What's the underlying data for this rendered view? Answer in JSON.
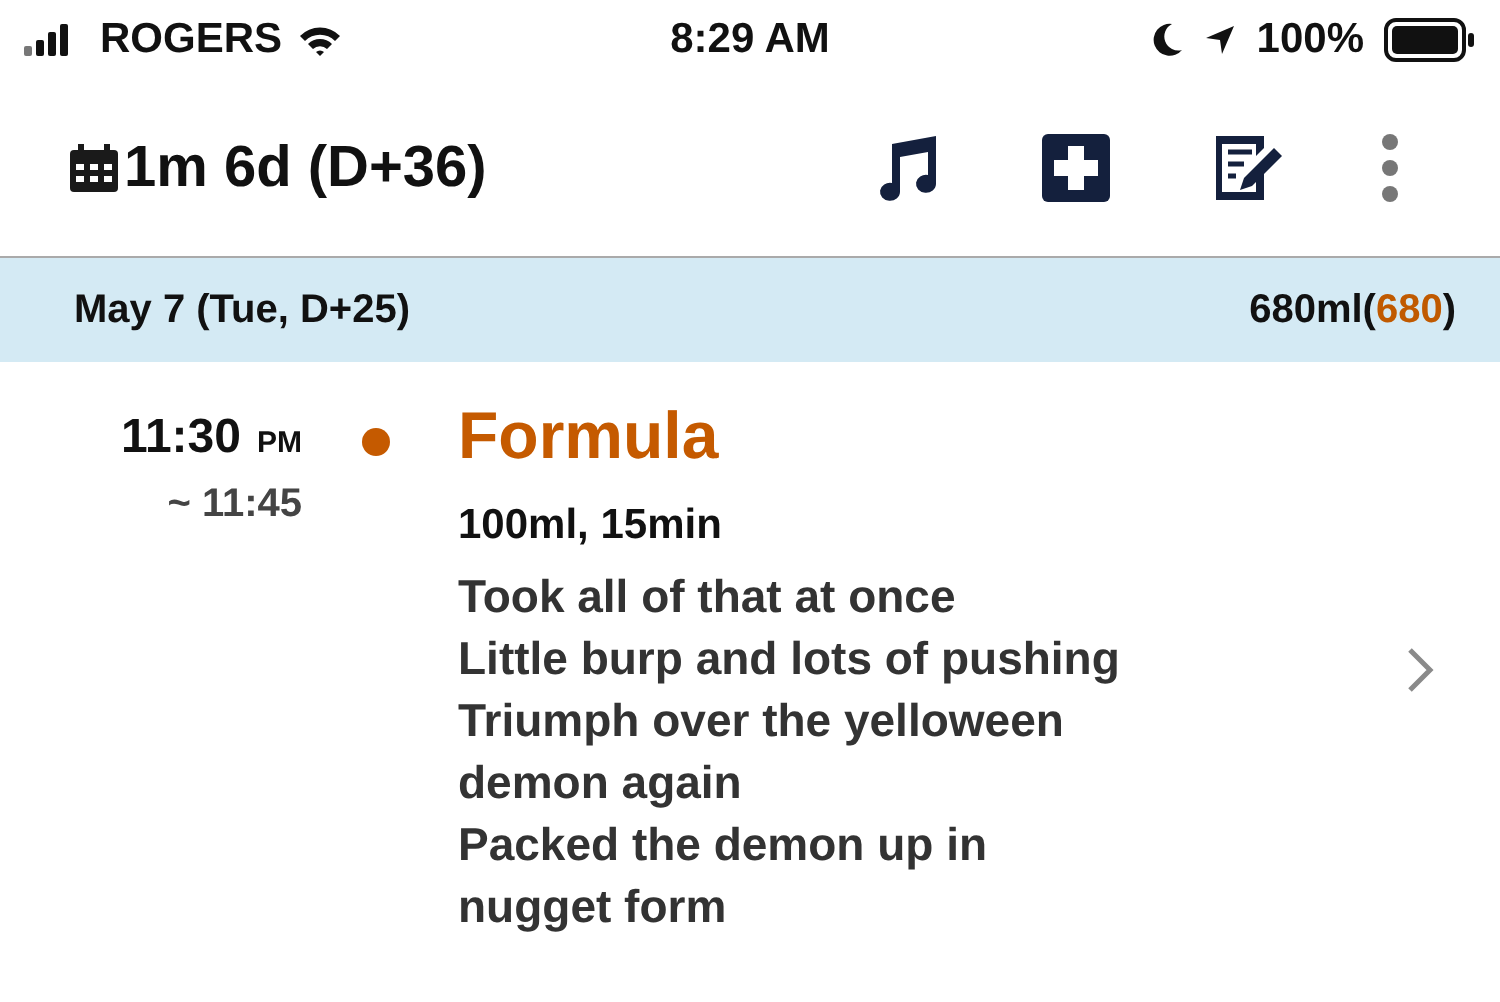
{
  "status_bar": {
    "carrier": "ROGERS",
    "time": "8:29 AM",
    "battery": "100%"
  },
  "header": {
    "title": "1m 6d (D+36)"
  },
  "day": {
    "label": "May 7 (Tue, D+25)",
    "total": [
      {
        "text": "680ml(",
        "kind": "plain"
      },
      {
        "text": "680",
        "kind": "highlight"
      },
      {
        "text": ")",
        "kind": "plain"
      }
    ]
  },
  "entries": [
    {
      "time": "11:30",
      "meridiem": "PM",
      "end": "~ 11:45",
      "color": "#c55a00",
      "title": "Formula",
      "summary": "100ml, 15min",
      "notes": [
        "Took all of that at once",
        "Little burp and lots of pushing",
        "Triumph over the yelloween",
        "demon again",
        "Packed the demon up in",
        "nugget form"
      ]
    }
  ]
}
